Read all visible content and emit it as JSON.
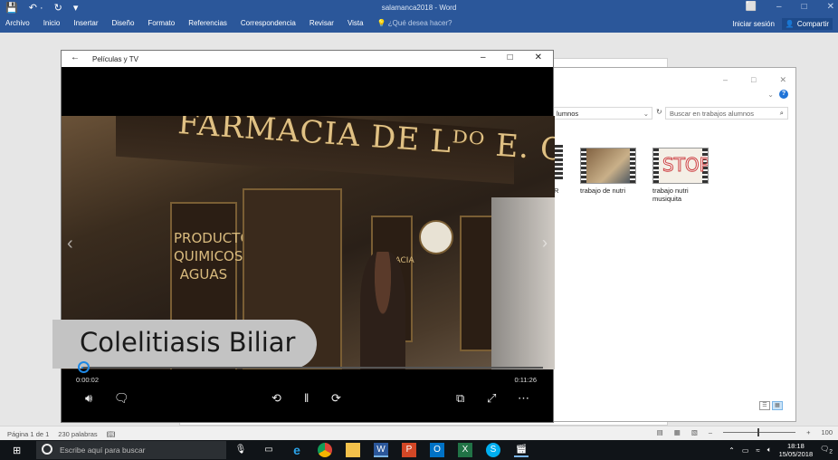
{
  "word": {
    "doc_title": "salamanca2018 - Word",
    "qat": [
      "💾",
      "↶ ·",
      "↻",
      "▾"
    ],
    "window_controls": [
      "⬜",
      "–",
      "□",
      "✕"
    ],
    "tabs": [
      "Archivo",
      "Inicio",
      "Insertar",
      "Diseño",
      "Formato",
      "Referencias",
      "Correspondencia",
      "Revisar",
      "Vista"
    ],
    "tell_me": "¿Qué desea hacer?",
    "sign_in": "Iniciar sesión",
    "share": "Compartir"
  },
  "explorer": {
    "controls": [
      "–",
      "□",
      "✕"
    ],
    "address": "lumnos",
    "search_placeholder": "Buscar en trabajos alumnos",
    "partial_label": "R",
    "files": [
      {
        "name": "trabajo de nutri"
      },
      {
        "name": "trabajo nutri musiquita"
      }
    ]
  },
  "player": {
    "app_title": "Películas y TV",
    "controls": [
      "–",
      "□",
      "✕"
    ],
    "video_sign": "FARMACIA DE Lᴰᴼ E. CANO",
    "panel_text_1": "PRODUCTOS QUIMICOS AGUAS",
    "panel_text_2": "FARMACIA",
    "caption": "Colelitiasis Biliar",
    "time_current": "0:00:02",
    "time_total": "0:11:26",
    "progress_fraction": 0.003
  },
  "statusbar": {
    "page": "Página 1 de 1",
    "words": "230 palabras",
    "zoom": "100"
  },
  "taskbar": {
    "search_placeholder": "Escribe aquí para buscar",
    "time": "18:18",
    "date": "15/05/2018",
    "notifications": "2"
  }
}
